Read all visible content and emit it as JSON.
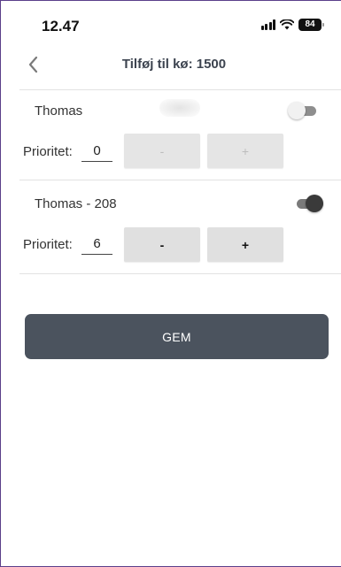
{
  "status_bar": {
    "time": "12.47",
    "battery": "84",
    "icons": [
      "signal-icon",
      "wifi-icon",
      "battery-icon"
    ]
  },
  "header": {
    "back_icon": "chevron-left-icon",
    "title": "Tilføj til kø: 1500"
  },
  "rows": [
    {
      "name": "Thomas",
      "enabled": false,
      "priority_label": "Prioritet:",
      "priority_value": "0",
      "minus_label": "-",
      "plus_label": "+"
    },
    {
      "name": "Thomas - 208",
      "enabled": true,
      "priority_label": "Prioritet:",
      "priority_value": "6",
      "minus_label": "-",
      "plus_label": "+"
    }
  ],
  "save_label": "GEM",
  "colors": {
    "save_button": "#4b535e",
    "title": "#3d4450",
    "button_bg": "#e0e0e0"
  }
}
